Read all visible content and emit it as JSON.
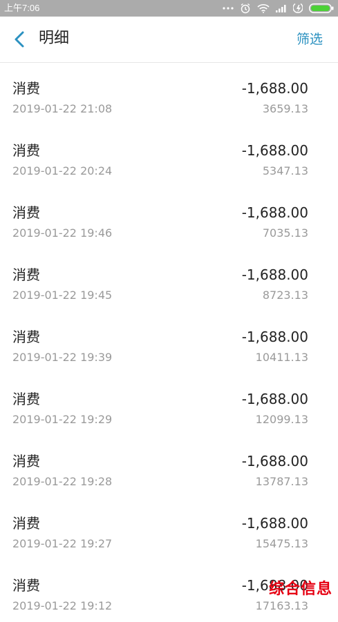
{
  "status_bar": {
    "time": "上午7:06",
    "icons": [
      "more-dots-icon",
      "alarm-icon",
      "wifi-icon",
      "signal-icon",
      "charging-icon",
      "battery-icon"
    ]
  },
  "header": {
    "title": "明细",
    "filter_label": "筛选",
    "accent_color": "#2b91c0"
  },
  "records": [
    {
      "type": "消费",
      "time": "2019-01-22 21:08",
      "amount": "-1,688.00",
      "balance": "3659.13"
    },
    {
      "type": "消费",
      "time": "2019-01-22 20:24",
      "amount": "-1,688.00",
      "balance": "5347.13"
    },
    {
      "type": "消费",
      "time": "2019-01-22 19:46",
      "amount": "-1,688.00",
      "balance": "7035.13"
    },
    {
      "type": "消费",
      "time": "2019-01-22 19:45",
      "amount": "-1,688.00",
      "balance": "8723.13"
    },
    {
      "type": "消费",
      "time": "2019-01-22 19:39",
      "amount": "-1,688.00",
      "balance": "10411.13"
    },
    {
      "type": "消费",
      "time": "2019-01-22 19:29",
      "amount": "-1,688.00",
      "balance": "12099.13"
    },
    {
      "type": "消费",
      "time": "2019-01-22 19:28",
      "amount": "-1,688.00",
      "balance": "13787.13"
    },
    {
      "type": "消费",
      "time": "2019-01-22 19:27",
      "amount": "-1,688.00",
      "balance": "15475.13"
    },
    {
      "type": "消费",
      "time": "2019-01-22 19:12",
      "amount": "-1,688.00",
      "balance": "17163.13"
    }
  ],
  "watermark": "综合信息"
}
